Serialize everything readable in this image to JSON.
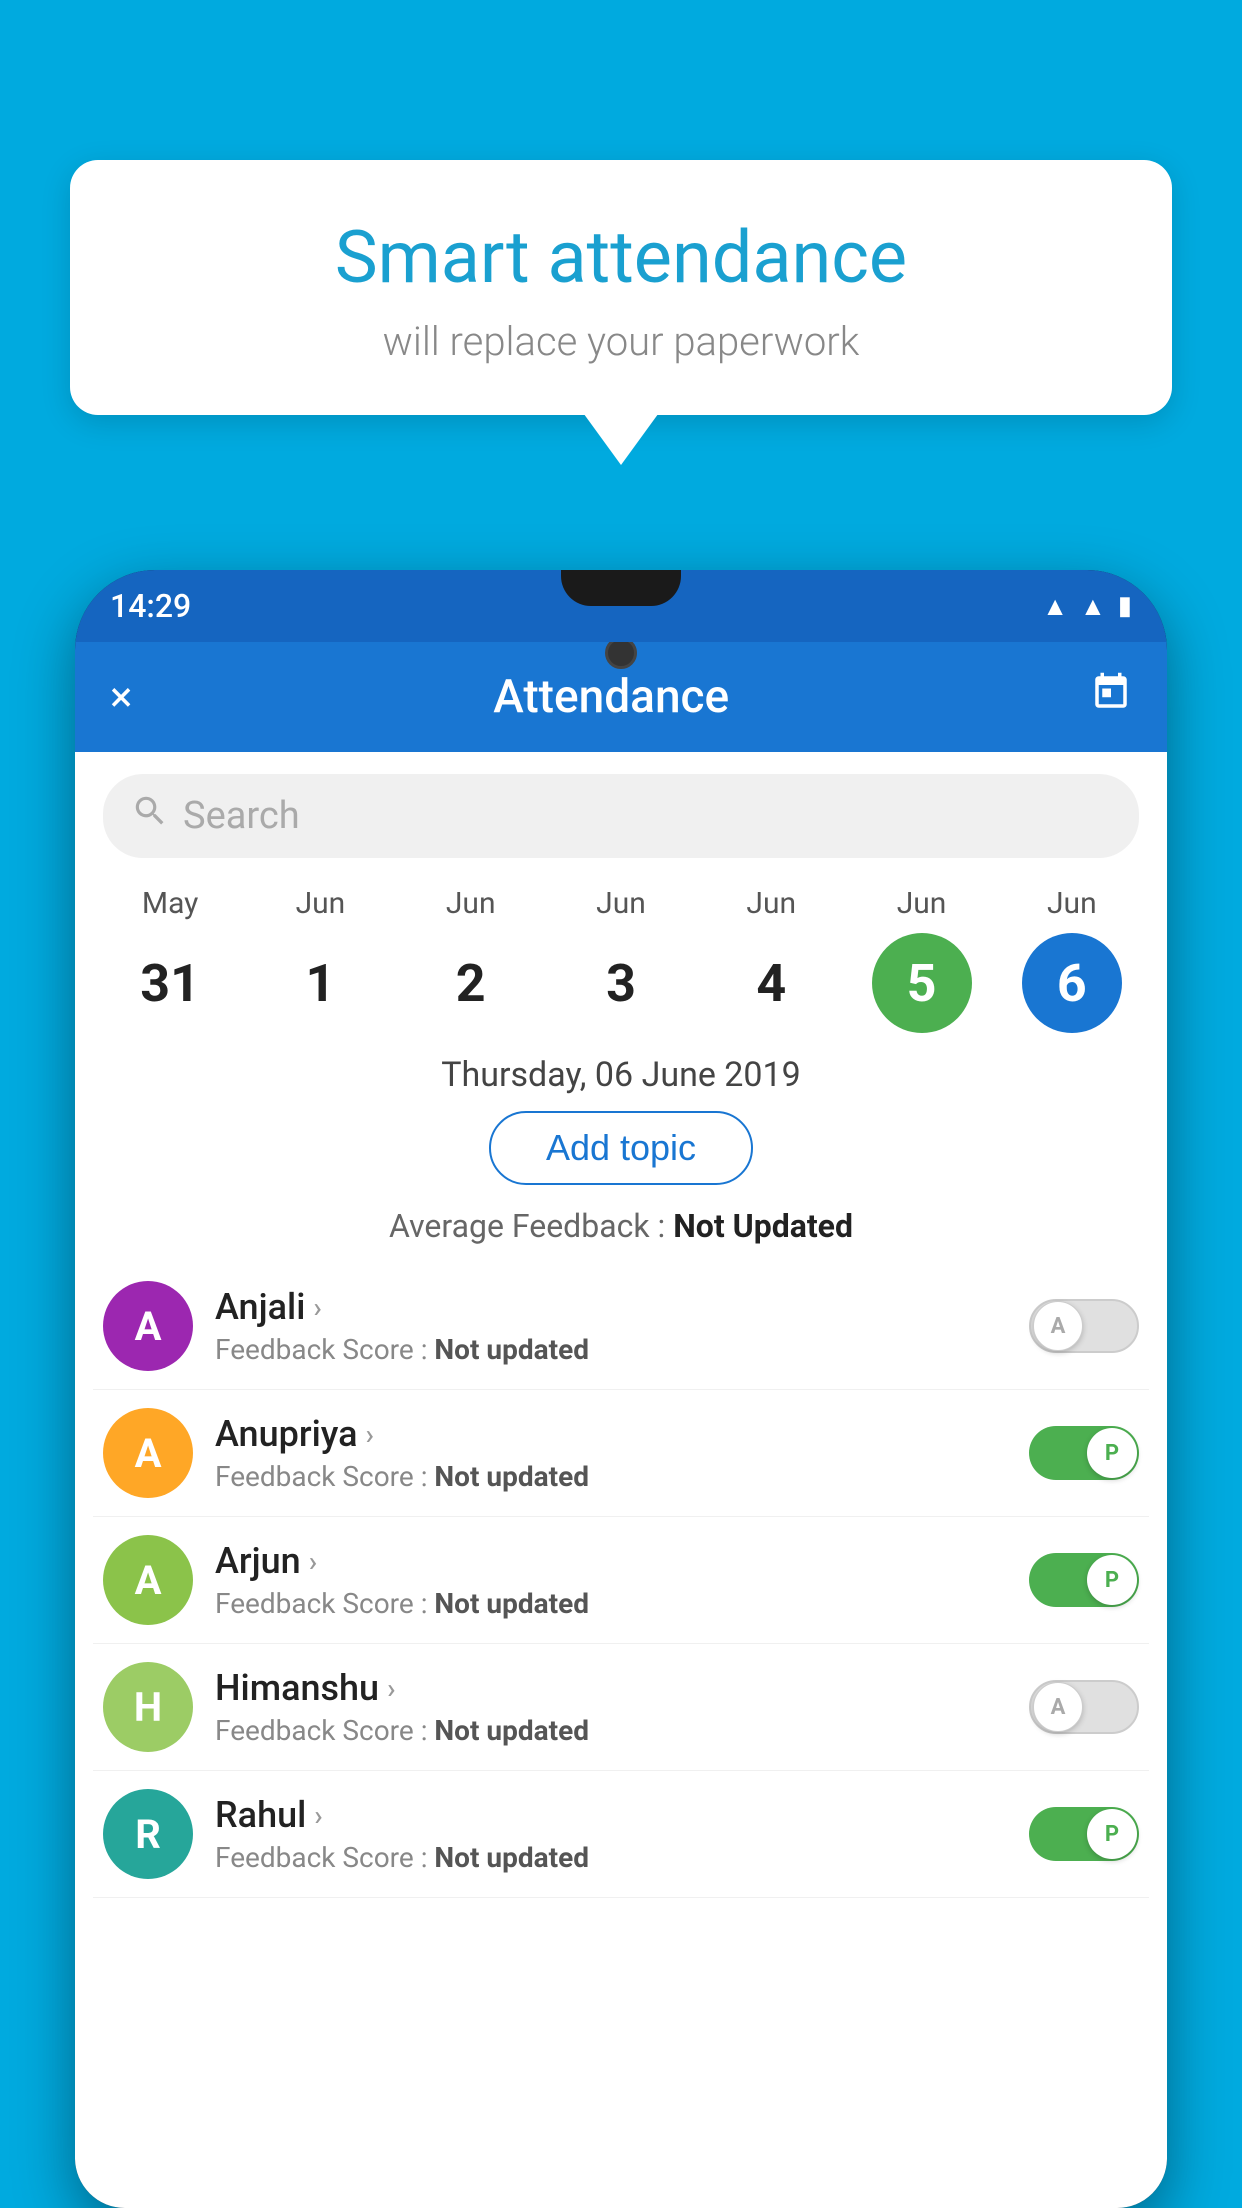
{
  "background_color": "#00AADF",
  "bubble": {
    "title": "Smart attendance",
    "subtitle": "will replace your paperwork"
  },
  "status_bar": {
    "time": "14:29",
    "icons": [
      "wifi",
      "signal",
      "battery"
    ]
  },
  "app_bar": {
    "title": "Attendance",
    "close_icon": "×",
    "calendar_icon": "📅"
  },
  "search": {
    "placeholder": "Search"
  },
  "calendar": {
    "days": [
      {
        "month": "May",
        "date": "31",
        "style": "normal"
      },
      {
        "month": "Jun",
        "date": "1",
        "style": "normal"
      },
      {
        "month": "Jun",
        "date": "2",
        "style": "normal"
      },
      {
        "month": "Jun",
        "date": "3",
        "style": "normal"
      },
      {
        "month": "Jun",
        "date": "4",
        "style": "normal"
      },
      {
        "month": "Jun",
        "date": "5",
        "style": "today"
      },
      {
        "month": "Jun",
        "date": "6",
        "style": "selected"
      }
    ],
    "selected_date_label": "Thursday, 06 June 2019"
  },
  "add_topic_button": "Add topic",
  "avg_feedback_label": "Average Feedback :",
  "avg_feedback_value": "Not Updated",
  "students": [
    {
      "name": "Anjali",
      "avatar_letter": "A",
      "avatar_color": "purple",
      "feedback": "Not updated",
      "status": "absent"
    },
    {
      "name": "Anupriya",
      "avatar_letter": "A",
      "avatar_color": "yellow",
      "feedback": "Not updated",
      "status": "present"
    },
    {
      "name": "Arjun",
      "avatar_letter": "A",
      "avatar_color": "green-light",
      "feedback": "Not updated",
      "status": "present"
    },
    {
      "name": "Himanshu",
      "avatar_letter": "H",
      "avatar_color": "olive",
      "feedback": "Not updated",
      "status": "absent"
    },
    {
      "name": "Rahul",
      "avatar_letter": "R",
      "avatar_color": "teal",
      "feedback": "Not updated",
      "status": "present"
    }
  ],
  "toggle_labels": {
    "absent": "A",
    "present": "P"
  }
}
